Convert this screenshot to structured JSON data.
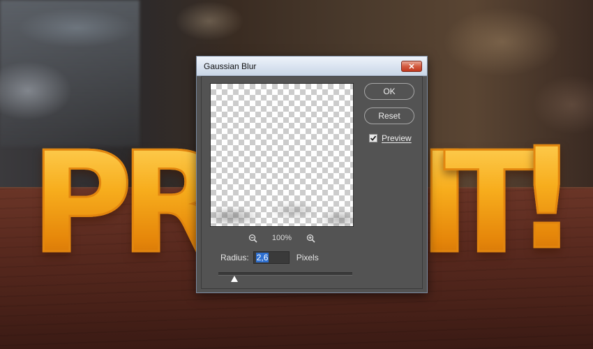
{
  "scene": {
    "letters": [
      "P",
      "R",
      "I",
      "T",
      "!"
    ]
  },
  "dialog": {
    "title": "Gaussian Blur",
    "close_symbol": "✕",
    "ok_label": "OK",
    "reset_label": "Reset",
    "preview_label": "Preview",
    "preview_checked": true,
    "zoom_level": "100%",
    "radius_label": "Radius:",
    "radius_value": "2,6",
    "radius_units": "Pixels",
    "zoom_out_icon": "zoom-out-icon",
    "zoom_in_icon": "zoom-in-icon"
  },
  "colors": {
    "dialog_bg": "#535353",
    "selection": "#2d6fd0",
    "letters": "#f4a214"
  }
}
